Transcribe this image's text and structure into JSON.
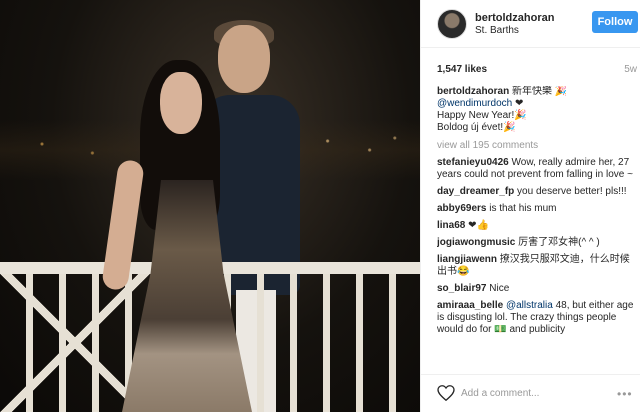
{
  "header": {
    "username": "bertoldzahoran",
    "location": "St. Barths",
    "follow_label": "Follow"
  },
  "post": {
    "likes": "1,547 likes",
    "age": "5w"
  },
  "caption": {
    "username": "bertoldzahoran",
    "line1": "新年快樂 🎉",
    "mention": "@wendimurdoch",
    "mention_suffix": " ❤",
    "line2": "Happy New Year!🎉",
    "line3": "Boldog új évet!🎉"
  },
  "view_all": "view all 195 comments",
  "comments": [
    {
      "user": "stefanieyu0426",
      "text": " Wow, really admire her, 27 years could not prevent from falling in love ~"
    },
    {
      "user": "day_dreamer_fp",
      "text": " you deserve better! pls!!!"
    },
    {
      "user": "abby69ers",
      "text": " is that his mum"
    },
    {
      "user": "lina68",
      "text": " ❤👍"
    },
    {
      "user": "jogiawongmusic",
      "text": " 厉害了邓女神(^ ^ )"
    },
    {
      "user": "liangjiawenn",
      "text": " 撩汉我只服邓文迪，什么时候出书😂"
    },
    {
      "user": "so_blair97",
      "text": " Nice"
    },
    {
      "user": "amiraaa_belle",
      "mention": "@allstralia",
      "text": " 48, but either age is disgusting lol. The crazy things people would do for 💵 and publicity"
    }
  ],
  "add_comment": {
    "placeholder": "Add a comment...",
    "more": "•••"
  },
  "icons": {
    "heart": "heart-icon",
    "more": "more-icon"
  },
  "colors": {
    "follow_button": "#3897f0",
    "mention": "#003569",
    "muted": "#999999"
  }
}
